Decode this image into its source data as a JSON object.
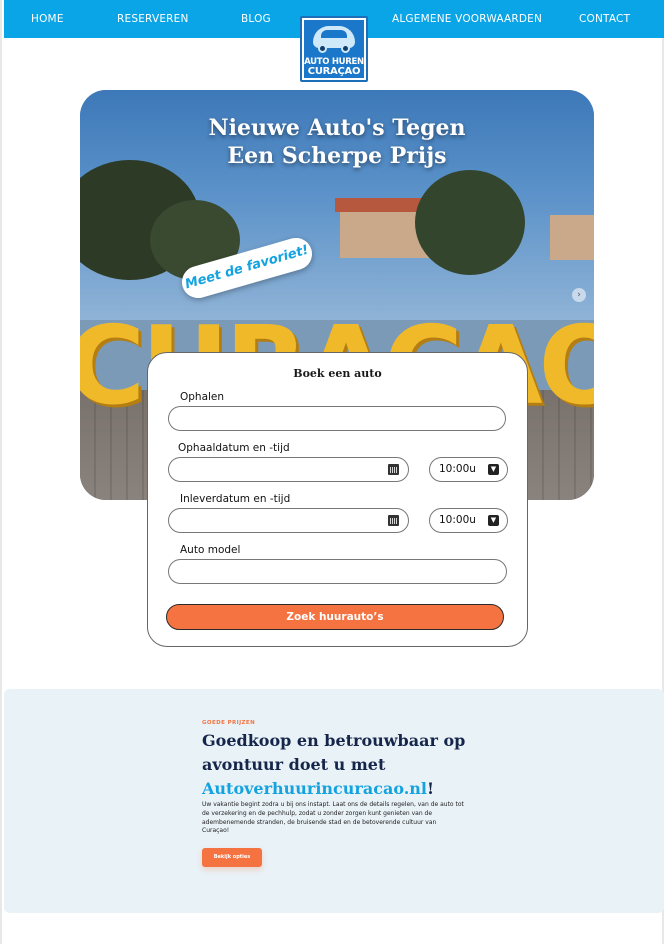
{
  "nav": {
    "items": [
      "HOME",
      "RESERVEREN",
      "BLOG",
      "ALGEMENE VOORWAARDEN",
      "CONTACT"
    ],
    "color": "#0aa5e6"
  },
  "logo": {
    "line1": "AUTO HUREN",
    "line2": "CURAÇAO"
  },
  "hero": {
    "title_line1": "Nieuwe Auto's Tegen",
    "title_line2": "Een Scherpe Prijs",
    "badge": "Meet de favoriet!",
    "sign_text": "CURAÇAO"
  },
  "booking": {
    "title": "Boek een auto",
    "pickup_label": "Ophalen",
    "pickup_value": "",
    "pickup_datetime_label": "Ophaaldatum en -tijd",
    "pickup_time": "10:00u",
    "return_datetime_label": "Inleverdatum en -tijd",
    "return_time": "10:00u",
    "model_label": "Auto model",
    "model_value": "",
    "search_button": "Zoek huurauto’s",
    "calendar_icon": "calendar-icon",
    "dropdown_icon": "chevron-down-icon"
  },
  "promo": {
    "kicker": "GOEDE PRIJZEN",
    "title_line1": "Goedkoop en betrouwbaar op",
    "title_line2": "avontuur doet u met",
    "brand": "Autoverhuurincuracao.nl",
    "brand_suffix": "!",
    "body": "Uw vakantie begint zodra u bij ons instapt. Laat ons de details regelen, van de auto tot de verzekering en de pechhulp, zodat u zonder zorgen kunt genieten van de adembenemende stranden, de bruisende stad en de betoverende cultuur van Curaçao!",
    "button": "Bekijk opties"
  },
  "colors": {
    "accent_orange": "#f47340",
    "brand_blue": "#15a3e0",
    "navy": "#16264a",
    "promo_bg": "#e9f2f7"
  }
}
